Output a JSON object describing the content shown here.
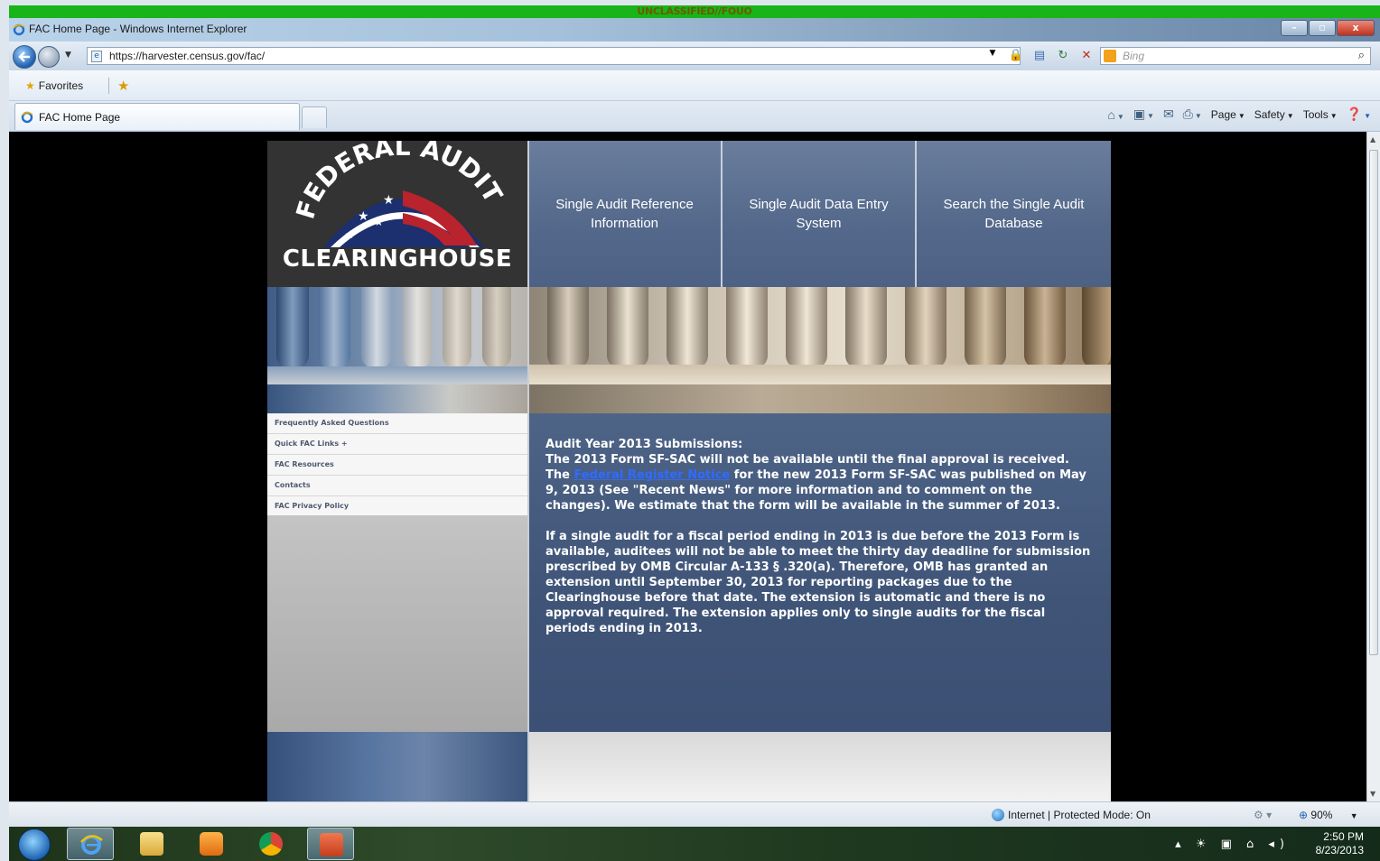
{
  "classification_banner": "UNCLASSIFIED//FOUO",
  "window": {
    "title": "FAC Home Page - Windows Internet Explorer",
    "minimize": "–",
    "maximize": "▫",
    "close": "x"
  },
  "address_bar": {
    "url": "https://harvester.census.gov/fac/"
  },
  "search": {
    "placeholder": "Bing"
  },
  "favorites_bar": {
    "favorites_label": "Favorites"
  },
  "tabs": [
    {
      "label": "FAC Home Page",
      "active": true
    }
  ],
  "command_bar": {
    "page_label": "Page",
    "safety_label": "Safety",
    "tools_label": "Tools"
  },
  "site": {
    "logo_arc_text": "FEDERAL AUDIT",
    "logo_word": "CLEARINGHOUSE",
    "nav_tabs": [
      {
        "label": "Single Audit Reference Information"
      },
      {
        "label": "Single Audit Data Entry System"
      },
      {
        "label": "Search the Single Audit Database"
      }
    ],
    "side_nav": [
      {
        "label": "Frequently Asked Questions"
      },
      {
        "label": "Quick FAC Links +"
      },
      {
        "label": "FAC Resources"
      },
      {
        "label": "Contacts"
      },
      {
        "label": "FAC Privacy Policy"
      }
    ],
    "announcement": {
      "heading": "Audit Year 2013 Submissions:",
      "line1": "The 2013 Form SF-SAC will not be available until the final approval is received.",
      "p1_prefix": "The ",
      "p1_link": "Federal Register Notice",
      "p1_suffix": " for the new 2013 Form SF-SAC was published on May 9, 2013 (See \"Recent News\" for more information and to comment on the changes). We estimate that the form will be available in the summer of 2013.",
      "p2": "If a single audit for a fiscal period ending in 2013 is due before the 2013 Form is available, auditees will not be able to meet the thirty day deadline for submission prescribed by OMB Circular A-133 § .320(a). Therefore, OMB has granted an extension until September 30, 2013 for reporting packages due to the Clearinghouse before that date. The extension is automatic and there is no approval required. The extension applies only to single audits for the fiscal periods ending in 2013."
    }
  },
  "status_bar": {
    "zone": "Internet | Protected Mode: On",
    "zoom": "90%"
  },
  "taskbar": {
    "time": "2:50 PM",
    "date": "8/23/2013"
  },
  "colors": {
    "classification_green": "#18b418",
    "nav_tab_blue": "#53688a",
    "content_blue": "#3f5477",
    "link_blue": "#2f6bff"
  }
}
